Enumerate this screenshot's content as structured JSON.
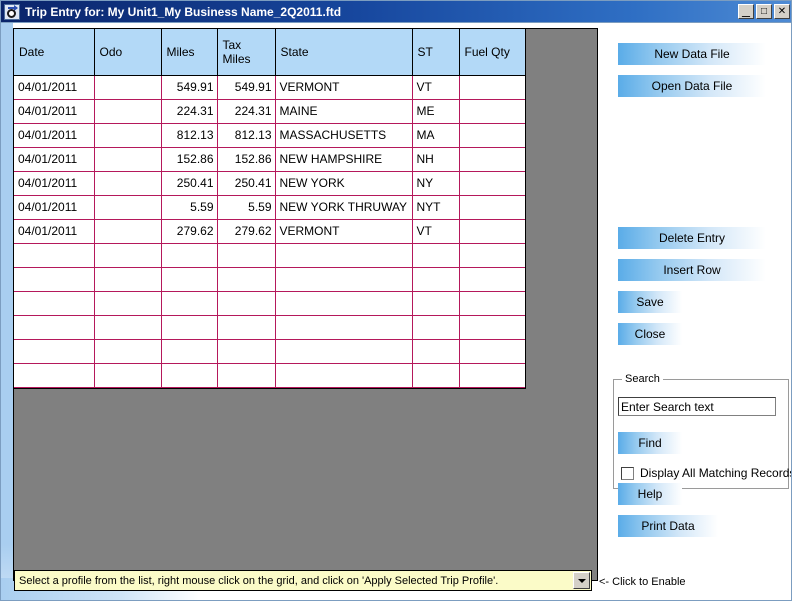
{
  "window": {
    "title": "Trip Entry for: My Unit1_My Business Name_2Q2011.ftd",
    "icon": "trip-entry-icon",
    "controls": {
      "minimize": "_",
      "maximize": "□",
      "close": "✕"
    }
  },
  "grid": {
    "columns": [
      "Date",
      "Odo",
      "Miles",
      "Tax\nMiles",
      "State",
      "ST",
      "Fuel Qty"
    ],
    "column_labels": {
      "date": "Date",
      "odo": "Odo",
      "miles": "Miles",
      "tax_miles_line1": "Tax",
      "tax_miles_line2": "Miles",
      "state": "State",
      "st": "ST",
      "fuel_qty": "Fuel Qty"
    },
    "rows": [
      {
        "date": "04/01/2011",
        "odo": "",
        "miles": "549.91",
        "tax_miles": "549.91",
        "state": "VERMONT",
        "st": "VT",
        "fuel_qty": ""
      },
      {
        "date": "04/01/2011",
        "odo": "",
        "miles": "224.31",
        "tax_miles": "224.31",
        "state": "MAINE",
        "st": "ME",
        "fuel_qty": ""
      },
      {
        "date": "04/01/2011",
        "odo": "",
        "miles": "812.13",
        "tax_miles": "812.13",
        "state": "MASSACHUSETTS",
        "st": "MA",
        "fuel_qty": ""
      },
      {
        "date": "04/01/2011",
        "odo": "",
        "miles": "152.86",
        "tax_miles": "152.86",
        "state": "NEW HAMPSHIRE",
        "st": "NH",
        "fuel_qty": ""
      },
      {
        "date": "04/01/2011",
        "odo": "",
        "miles": "250.41",
        "tax_miles": "250.41",
        "state": "NEW YORK",
        "st": "NY",
        "fuel_qty": ""
      },
      {
        "date": "04/01/2011",
        "odo": "",
        "miles": "5.59",
        "tax_miles": "5.59",
        "state": "NEW YORK THRUWAY",
        "st": "NYT",
        "fuel_qty": ""
      },
      {
        "date": "04/01/2011",
        "odo": "",
        "miles": "279.62",
        "tax_miles": "279.62",
        "state": "VERMONT",
        "st": "VT",
        "fuel_qty": ""
      },
      {
        "date": "",
        "odo": "",
        "miles": "",
        "tax_miles": "",
        "state": "",
        "st": "",
        "fuel_qty": ""
      },
      {
        "date": "",
        "odo": "",
        "miles": "",
        "tax_miles": "",
        "state": "",
        "st": "",
        "fuel_qty": ""
      },
      {
        "date": "",
        "odo": "",
        "miles": "",
        "tax_miles": "",
        "state": "",
        "st": "",
        "fuel_qty": ""
      },
      {
        "date": "",
        "odo": "",
        "miles": "",
        "tax_miles": "",
        "state": "",
        "st": "",
        "fuel_qty": ""
      },
      {
        "date": "",
        "odo": "",
        "miles": "",
        "tax_miles": "",
        "state": "",
        "st": "",
        "fuel_qty": ""
      },
      {
        "date": "",
        "odo": "",
        "miles": "",
        "tax_miles": "",
        "state": "",
        "st": "",
        "fuel_qty": ""
      }
    ]
  },
  "sidebar": {
    "new_data_file": "New Data File",
    "open_data_file": "Open Data File",
    "delete_entry": "Delete Entry",
    "insert_row": "Insert Row",
    "save": "Save",
    "close": "Close",
    "help": "Help",
    "print_data": "Print Data"
  },
  "search": {
    "group_title": "Search",
    "input_value": "Enter Search text",
    "find_label": "Find",
    "checkbox_label": "Display All Matching Records",
    "checkbox_checked": false
  },
  "statusbar": {
    "combo_value": "Select a profile from the list, right mouse click on the grid, and click on 'Apply Selected Trip Profile'.",
    "hint": "<- Click to Enable"
  },
  "colors": {
    "titlebar_start": "#0a246a",
    "header_blue": "#b3d9f7",
    "grid_line": "#b5185b",
    "panel_gray": "#808080",
    "combo_yellow": "#fbfbc8",
    "button_blue": "#5aace8"
  }
}
